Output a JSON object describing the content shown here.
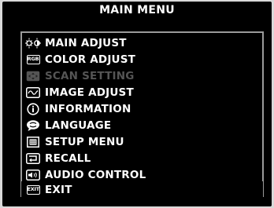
{
  "menu": {
    "title": "MAIN MENU",
    "items": [
      {
        "label": "MAIN ADJUST",
        "icon": "brightness-contrast-icon",
        "enabled": true
      },
      {
        "label": "COLOR ADJUST",
        "icon": "rgb-icon",
        "icon_text": "RGB",
        "enabled": true
      },
      {
        "label": "SCAN SETTING",
        "icon": "scan-icon",
        "enabled": false
      },
      {
        "label": "IMAGE ADJUST",
        "icon": "waveform-icon",
        "enabled": true
      },
      {
        "label": "INFORMATION",
        "icon": "info-icon",
        "enabled": true
      },
      {
        "label": "LANGUAGE",
        "icon": "speech-icon",
        "enabled": true
      },
      {
        "label": "SETUP MENU",
        "icon": "menu-list-icon",
        "enabled": true
      },
      {
        "label": "RECALL",
        "icon": "return-arrow-icon",
        "enabled": true
      },
      {
        "label": "AUDIO CONTROL",
        "icon": "speaker-icon",
        "enabled": true
      },
      {
        "label": "EXIT",
        "icon": "exit-icon",
        "icon_text": "EXIT",
        "enabled": true
      }
    ],
    "colors": {
      "background": "#000000",
      "text": "#ffffff",
      "disabled_text": "#555555",
      "panel_border": "#9a9a9a"
    }
  }
}
